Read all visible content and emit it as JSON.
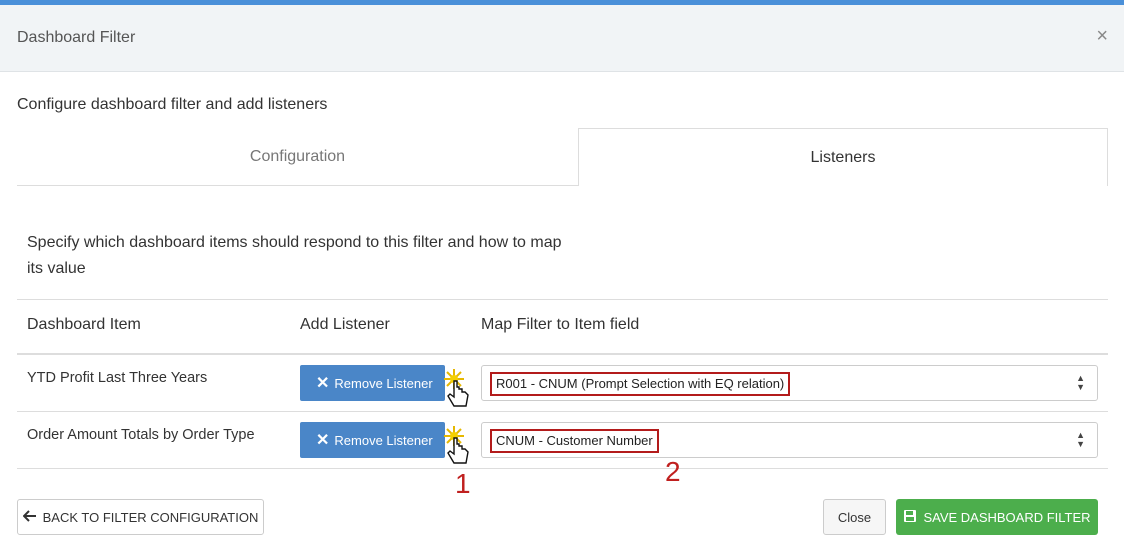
{
  "header": {
    "title": "Dashboard Filter",
    "close_glyph": "×"
  },
  "intro": "Configure dashboard filter and add listeners",
  "tabs": [
    {
      "label": "Configuration",
      "active": false
    },
    {
      "label": "Listeners",
      "active": true
    }
  ],
  "description": "Specify which dashboard items should respond to this filter and how to map its value",
  "table": {
    "headers": [
      "Dashboard Item",
      "Add Listener",
      "Map Filter to Item field"
    ],
    "rows": [
      {
        "item": "YTD Profit Last Three Years",
        "button": "Remove Listener",
        "mapping": "R001 - CNUM (Prompt Selection with EQ relation)"
      },
      {
        "item": "Order Amount Totals by Order Type",
        "button": "Remove Listener",
        "mapping": "CNUM - Customer Number"
      }
    ]
  },
  "annotations": [
    "1",
    "2"
  ],
  "footer": {
    "back_label": "BACK TO FILTER CONFIGURATION",
    "close_label": "Close",
    "save_label": "SAVE DASHBOARD FILTER"
  },
  "icons": {
    "remove": "x-icon",
    "back": "arrow-left-icon",
    "save": "floppy-disk-icon",
    "select": "sort-arrows-icon",
    "pointer": "hand-pointer-icon"
  },
  "colors": {
    "primary": "#4a86c8",
    "success": "#4cae4c",
    "annotation": "#c0201f",
    "topbar": "#4a90d9"
  }
}
